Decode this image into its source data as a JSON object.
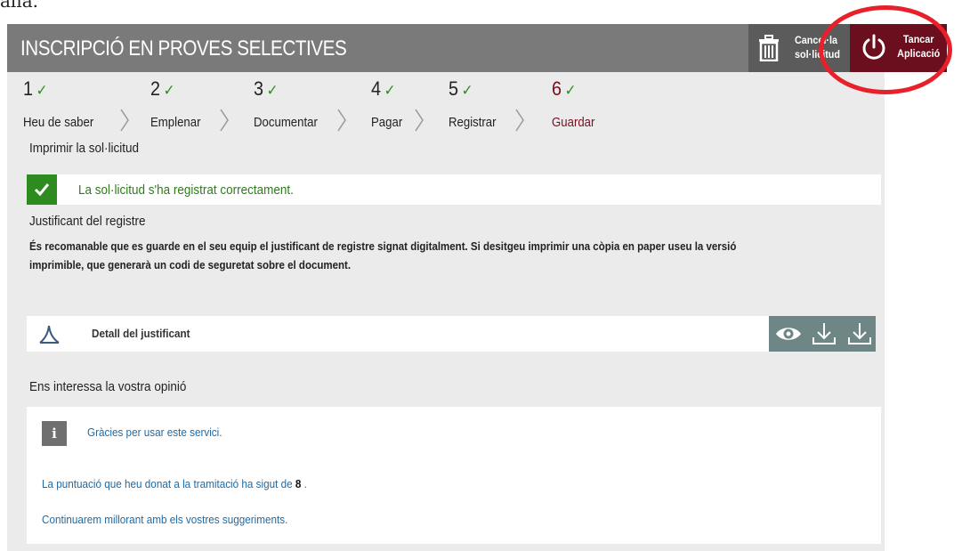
{
  "page_fragment": "alla.",
  "header": {
    "title": "INSCRIPCIÓ EN PROVES SELECTIVES",
    "cancel_label_1": "Cancel·la",
    "cancel_label_2": "sol·licitud",
    "close_label_1": "Tancar",
    "close_label_2": "Aplicació"
  },
  "steps": [
    {
      "number": "1",
      "name": "Heu de saber",
      "done": true
    },
    {
      "number": "2",
      "name": "Emplenar",
      "done": true
    },
    {
      "number": "3",
      "name": "Documentar",
      "done": true
    },
    {
      "number": "4",
      "name": "Pagar",
      "done": true
    },
    {
      "number": "5",
      "name": "Registrar",
      "done": true
    },
    {
      "number": "6",
      "name": "Guardar",
      "done": true,
      "current": true
    }
  ],
  "check_glyph": "✓",
  "print_section": {
    "title": "Imprimir la sol·licitud",
    "success_message": "La sol·licitud s'ha registrat correctament."
  },
  "receipt_section": {
    "title": "Justificant del registre",
    "description": "És recomanable que es guarde en el seu equip el justificant de registre signat digitalment. Si desitgeu imprimir una còpia en paper useu la versió imprimible, que generarà un codi de seguretat sobre el document.",
    "document_label": "Detall del justificant",
    "actions": [
      "eye-icon",
      "download-icon",
      "download-icon"
    ]
  },
  "feedback_section": {
    "title": "Ens interessa la vostra opinió",
    "info_icon": "i",
    "thanks": "Gràcies per usar este servici.",
    "score_prefix": "La puntuació que heu donat a la tramitació ha sigut de",
    "score_value": "8",
    "score_suffix": " .",
    "continue": "Continuarem millorant amb els vostres suggeriments."
  },
  "colors": {
    "header_bg": "#7a7a7a",
    "close_button_bg": "#6b0f1e",
    "success_green": "#2e8b1f",
    "current_step": "#7a0e1e",
    "link_blue": "#1f6aa5",
    "highlight_ring": "#e8202a"
  }
}
